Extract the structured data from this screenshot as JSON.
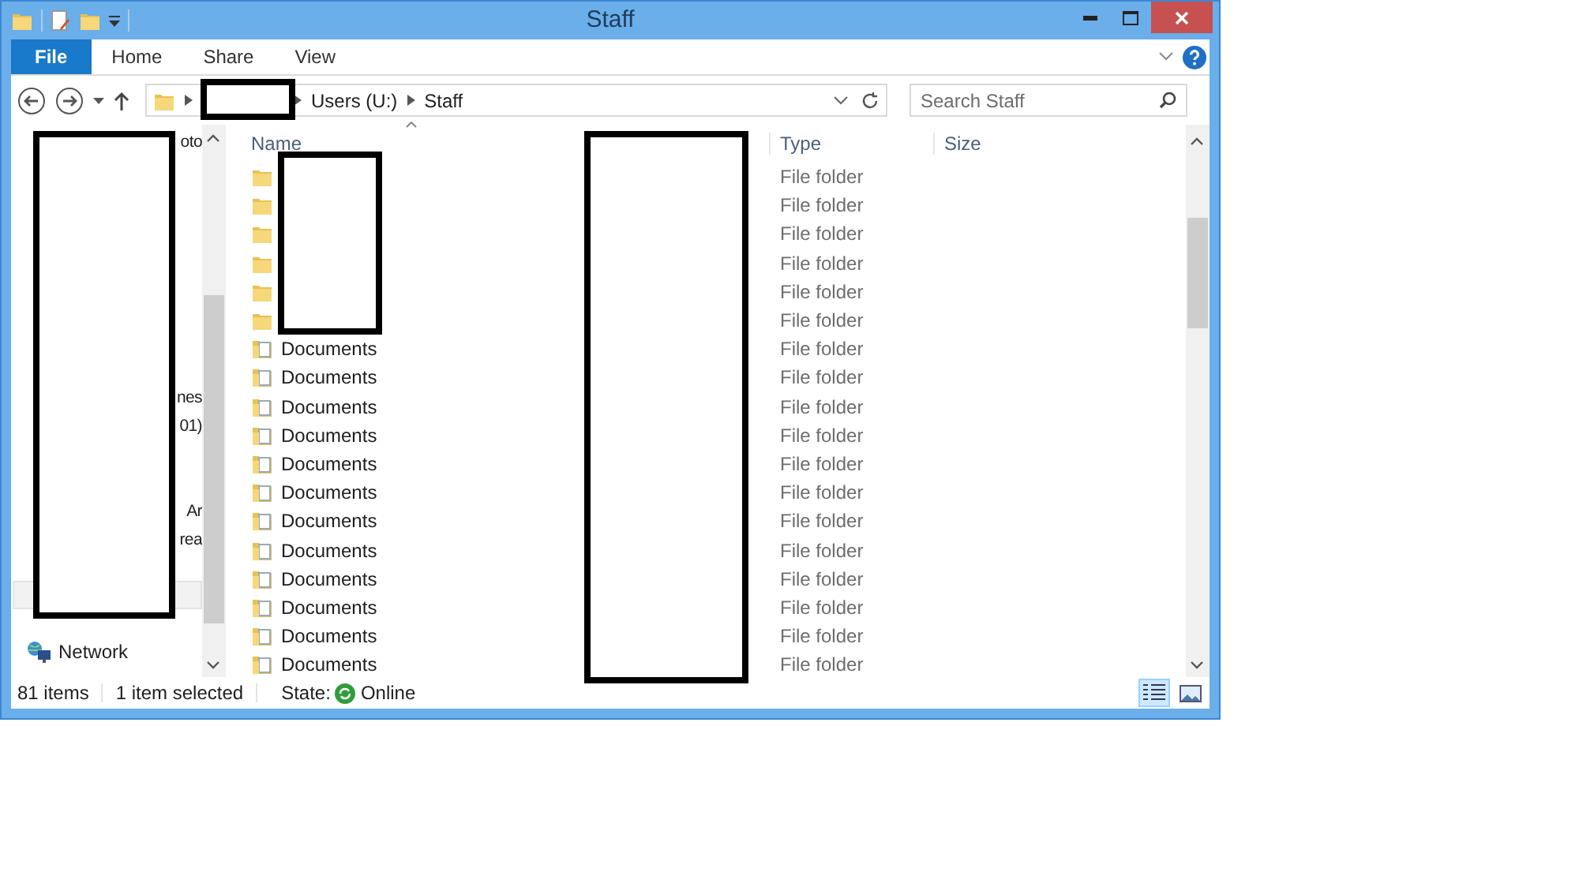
{
  "window": {
    "title": "Staff"
  },
  "ribbon": {
    "tabs": [
      {
        "label": "File",
        "kind": "file"
      },
      {
        "label": "Home",
        "kind": "tab"
      },
      {
        "label": "Share",
        "kind": "tab"
      },
      {
        "label": "View",
        "kind": "tab"
      }
    ]
  },
  "address": {
    "crumbs": [
      "Users (U:)",
      "Staff"
    ]
  },
  "search": {
    "placeholder": "Search Staff"
  },
  "navigation": {
    "fragments": [
      "oto",
      "nes",
      "01)",
      "Ar",
      "rea"
    ],
    "network": "Network"
  },
  "table": {
    "columns": [
      "Name",
      "Type",
      "Size"
    ],
    "rows": [
      {
        "kind": "folder",
        "type": "File folder"
      },
      {
        "kind": "folder",
        "type": "File folder"
      },
      {
        "kind": "folder",
        "type": "File folder"
      },
      {
        "kind": "folder",
        "type": "File folder"
      },
      {
        "kind": "folder",
        "type": "File folder"
      },
      {
        "kind": "folder",
        "type": "File folder"
      },
      {
        "kind": "documents",
        "name": "Documents",
        "type": "File folder"
      },
      {
        "kind": "documents",
        "name": "Documents",
        "type": "File folder"
      },
      {
        "kind": "documents",
        "name": "Documents",
        "type": "File folder"
      },
      {
        "kind": "documents",
        "name": "Documents",
        "type": "File folder"
      },
      {
        "kind": "documents",
        "name": "Documents",
        "type": "File folder"
      },
      {
        "kind": "documents",
        "name": "Documents",
        "type": "File folder"
      },
      {
        "kind": "documents",
        "name": "Documents",
        "type": "File folder"
      },
      {
        "kind": "documents",
        "name": "Documents",
        "type": "File folder"
      },
      {
        "kind": "documents",
        "name": "Documents",
        "type": "File folder"
      },
      {
        "kind": "documents",
        "name": "Documents",
        "type": "File folder"
      },
      {
        "kind": "documents",
        "name": "Documents",
        "type": "File folder"
      },
      {
        "kind": "documents",
        "name": "Documents",
        "type": "File folder"
      }
    ]
  },
  "status_bar": {
    "item_count": "81 items",
    "selection": "1 item selected",
    "state_label": "State:",
    "state": "Online"
  },
  "view_buttons": [
    {
      "kind": "details",
      "selected": true
    },
    {
      "kind": "large-icons",
      "selected": false
    }
  ]
}
